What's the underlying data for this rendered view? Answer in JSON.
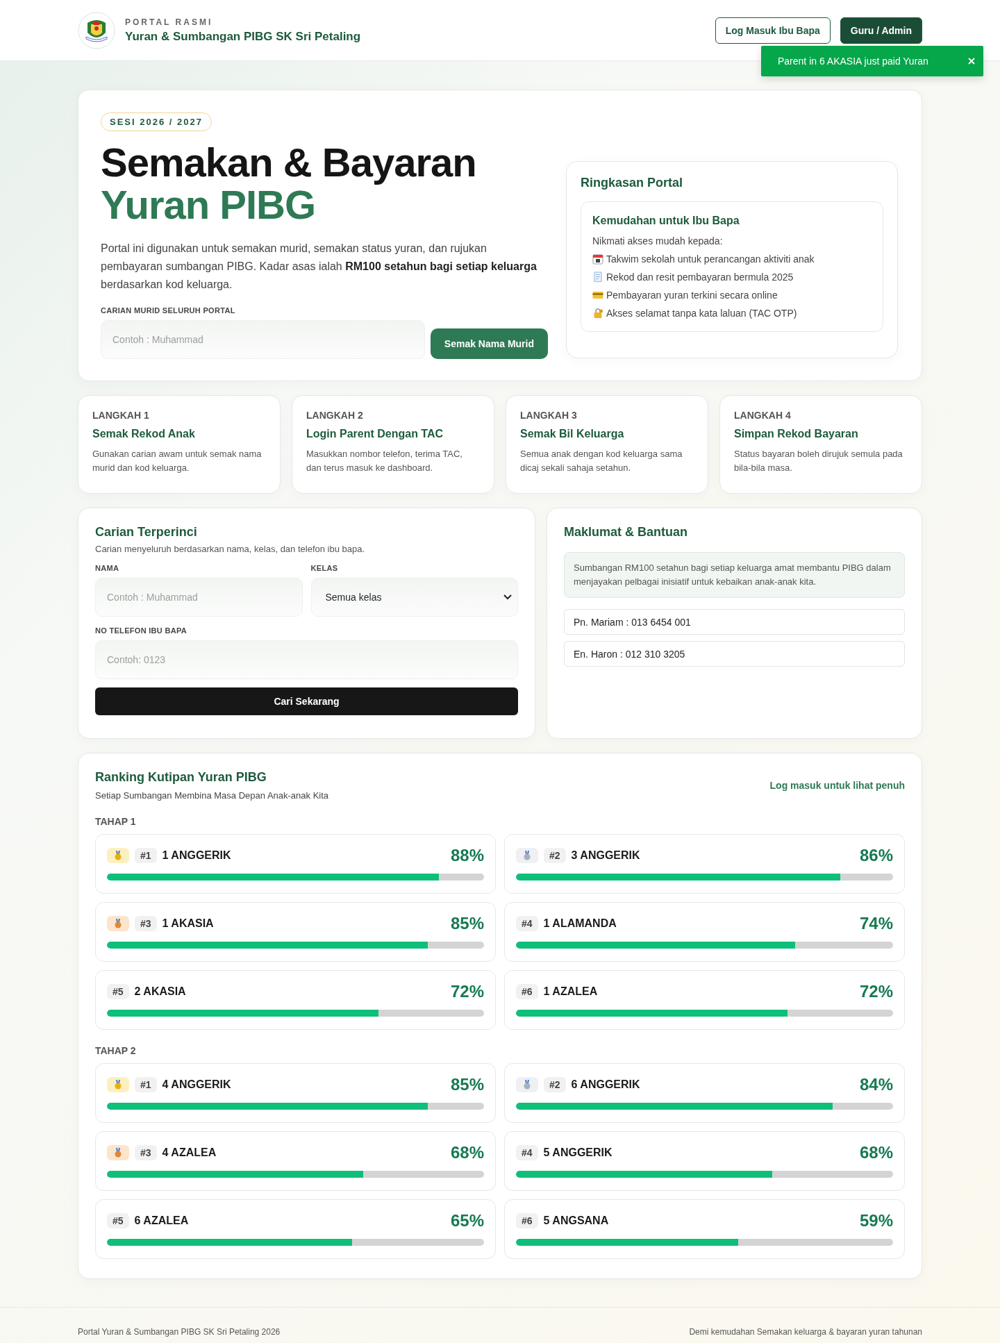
{
  "header": {
    "kicker": "PORTAL RASMI",
    "title": "Yuran & Sumbangan PIBG SK Sri Petaling",
    "buttons": [
      {
        "label": "Log Masuk Ibu Bapa",
        "kind": "outline"
      },
      {
        "label": "Guru / Admin",
        "kind": "solid"
      }
    ]
  },
  "toast": {
    "message": "Parent in 6 AKASIA just paid Yuran"
  },
  "hero": {
    "badge": "SESI 2026 / 2027",
    "title_line1": "Semakan & Bayaran",
    "title_line2": "Yuran PIBG",
    "description": "Portal ini digunakan untuk semakan murid, semakan status yuran, dan rujukan pembayaran sumbangan PIBG. Kadar asas ialah **RM100 setahun bagi setiap keluarga** berdasarkan kod keluarga.",
    "search_label": "CARIAN MURID SELURUH PORTAL",
    "search_placeholder": "Contoh : Muhammad",
    "search_button": "Semak Nama Murid"
  },
  "summary": {
    "title": "Ringkasan Portal",
    "box_title": "Kemudahan untuk Ibu Bapa",
    "intro": "Nikmati akses mudah kepada:",
    "items": [
      {
        "kind": "calendar",
        "text": "Takwim sekolah untuk perancangan aktiviti anak"
      },
      {
        "kind": "receipt",
        "text": "Rekod dan resit pembayaran bermula 2025"
      },
      {
        "kind": "card",
        "text": "Pembayaran yuran terkini secara online"
      },
      {
        "kind": "lock",
        "text": "Akses selamat tanpa kata laluan (TAC OTP)"
      }
    ]
  },
  "steps": [
    {
      "step": "LANGKAH 1",
      "title": "Semak Rekod Anak",
      "text": "Gunakan carian awam untuk semak nama murid dan kod keluarga."
    },
    {
      "step": "LANGKAH 2",
      "title": "Login Parent Dengan TAC",
      "text": "Masukkan nombor telefon, terima TAC, dan terus masuk ke dashboard."
    },
    {
      "step": "LANGKAH 3",
      "title": "Semak Bil Keluarga",
      "text": "Semua anak dengan kod keluarga sama dicaj sekali sahaja setahun."
    },
    {
      "step": "LANGKAH 4",
      "title": "Simpan Rekod Bayaran",
      "text": "Status bayaran boleh dirujuk semula pada bila-bila masa."
    }
  ],
  "detailed_search": {
    "title": "Carian Terperinci",
    "subtitle": "Carian menyeluruh berdasarkan nama, kelas, dan telefon ibu bapa.",
    "name_label": "NAMA",
    "name_placeholder": "Contoh : Muhammad",
    "class_label": "KELAS",
    "class_value": "Semua kelas",
    "phone_label": "NO TELEFON IBU BAPA",
    "phone_placeholder": "Contoh: 0123",
    "button": "Cari Sekarang"
  },
  "help": {
    "title": "Maklumat & Bantuan",
    "note": "Sumbangan RM100 setahun bagi setiap keluarga amat membantu PIBG dalam menjayakan pelbagai inisiatif untuk kebaikan anak-anak kita.",
    "contacts": [
      "Pn. Mariam : 013 6454 001",
      "En. Haron : 012 310 3205"
    ]
  },
  "ranking": {
    "title": "Ranking Kutipan Yuran PIBG",
    "subtitle": "Setiap Sumbangan Membina Masa Depan Anak-anak Kita",
    "link": "Log masuk untuk lihat penuh",
    "groups": [
      {
        "label": "TAHAP 1",
        "entries": [
          {
            "kind": "gold",
            "rank": "#1",
            "name": "1 ANGGERIK",
            "percent": "88%",
            "level": 0.88
          },
          {
            "kind": "silver",
            "rank": "#2",
            "name": "3 ANGGERIK",
            "percent": "86%",
            "level": 0.86
          },
          {
            "kind": "bronze",
            "rank": "#3",
            "name": "1 AKASIA",
            "percent": "85%",
            "level": 0.85
          },
          {
            "kind": "plain",
            "rank": "#4",
            "name": "1 ALAMANDA",
            "percent": "74%",
            "level": 0.74
          },
          {
            "kind": "plain",
            "rank": "#5",
            "name": "2 AKASIA",
            "percent": "72%",
            "level": 0.72
          },
          {
            "kind": "plain",
            "rank": "#6",
            "name": "1 AZALEA",
            "percent": "72%",
            "level": 0.72
          }
        ]
      },
      {
        "label": "TAHAP 2",
        "entries": [
          {
            "kind": "gold",
            "rank": "#1",
            "name": "4 ANGGERIK",
            "percent": "85%",
            "level": 0.85
          },
          {
            "kind": "silver",
            "rank": "#2",
            "name": "6 ANGGERIK",
            "percent": "84%",
            "level": 0.84
          },
          {
            "kind": "bronze",
            "rank": "#3",
            "name": "4 AZALEA",
            "percent": "68%",
            "level": 0.68
          },
          {
            "kind": "plain",
            "rank": "#4",
            "name": "5 ANGGERIK",
            "percent": "68%",
            "level": 0.68
          },
          {
            "kind": "plain",
            "rank": "#5",
            "name": "6 AZALEA",
            "percent": "65%",
            "level": 0.65
          },
          {
            "kind": "plain",
            "rank": "#6",
            "name": "5 ANGSANA",
            "percent": "59%",
            "level": 0.59
          }
        ]
      }
    ]
  },
  "footer": {
    "left": "Portal Yuran & Sumbangan PIBG SK Sri Petaling 2026",
    "right": "Demi kemudahan Semakan keluarga & bayaran yuran tahunan"
  }
}
